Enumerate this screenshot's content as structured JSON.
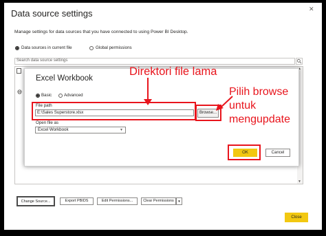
{
  "dialog": {
    "title": "Data source settings",
    "description": "Manage settings for data sources that you have connected to using Power BI Desktop.",
    "scope_options": [
      "Data sources in current file",
      "Global permissions"
    ],
    "search_placeholder": "Search data source settings",
    "buttons": {
      "change_source": "Change Source...",
      "export_pbids": "Export PBIDS",
      "edit_permissions": "Edit Permissions...",
      "clear_permissions": "Clear Permissions",
      "close": "Close"
    }
  },
  "modal": {
    "title": "Excel Workbook",
    "mode_options": [
      "Basic",
      "Advanced"
    ],
    "file_path_label": "File path",
    "file_path_value": "E:\\Sales Superstore.xlsx",
    "browse_label": "Browse...",
    "open_as_label": "Open file as",
    "open_as_value": "Excel Workbook",
    "ok_label": "OK",
    "cancel_label": "Cancel"
  },
  "annotations": {
    "old_dir": "Direktori file lama",
    "browse_note": [
      "Pilih browse",
      "untuk",
      "mengupdate"
    ]
  },
  "colors": {
    "accent_yellow": "#f2c811",
    "annotation_red": "#e8141c"
  }
}
